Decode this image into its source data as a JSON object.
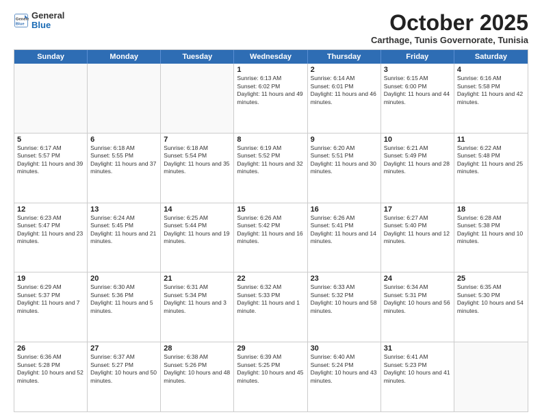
{
  "header": {
    "logo_line1": "General",
    "logo_line2": "Blue",
    "month": "October 2025",
    "location": "Carthage, Tunis Governorate, Tunisia"
  },
  "days_of_week": [
    "Sunday",
    "Monday",
    "Tuesday",
    "Wednesday",
    "Thursday",
    "Friday",
    "Saturday"
  ],
  "weeks": [
    [
      {
        "day": "",
        "text": ""
      },
      {
        "day": "",
        "text": ""
      },
      {
        "day": "",
        "text": ""
      },
      {
        "day": "1",
        "text": "Sunrise: 6:13 AM\nSunset: 6:02 PM\nDaylight: 11 hours and 49 minutes."
      },
      {
        "day": "2",
        "text": "Sunrise: 6:14 AM\nSunset: 6:01 PM\nDaylight: 11 hours and 46 minutes."
      },
      {
        "day": "3",
        "text": "Sunrise: 6:15 AM\nSunset: 6:00 PM\nDaylight: 11 hours and 44 minutes."
      },
      {
        "day": "4",
        "text": "Sunrise: 6:16 AM\nSunset: 5:58 PM\nDaylight: 11 hours and 42 minutes."
      }
    ],
    [
      {
        "day": "5",
        "text": "Sunrise: 6:17 AM\nSunset: 5:57 PM\nDaylight: 11 hours and 39 minutes."
      },
      {
        "day": "6",
        "text": "Sunrise: 6:18 AM\nSunset: 5:55 PM\nDaylight: 11 hours and 37 minutes."
      },
      {
        "day": "7",
        "text": "Sunrise: 6:18 AM\nSunset: 5:54 PM\nDaylight: 11 hours and 35 minutes."
      },
      {
        "day": "8",
        "text": "Sunrise: 6:19 AM\nSunset: 5:52 PM\nDaylight: 11 hours and 32 minutes."
      },
      {
        "day": "9",
        "text": "Sunrise: 6:20 AM\nSunset: 5:51 PM\nDaylight: 11 hours and 30 minutes."
      },
      {
        "day": "10",
        "text": "Sunrise: 6:21 AM\nSunset: 5:49 PM\nDaylight: 11 hours and 28 minutes."
      },
      {
        "day": "11",
        "text": "Sunrise: 6:22 AM\nSunset: 5:48 PM\nDaylight: 11 hours and 25 minutes."
      }
    ],
    [
      {
        "day": "12",
        "text": "Sunrise: 6:23 AM\nSunset: 5:47 PM\nDaylight: 11 hours and 23 minutes."
      },
      {
        "day": "13",
        "text": "Sunrise: 6:24 AM\nSunset: 5:45 PM\nDaylight: 11 hours and 21 minutes."
      },
      {
        "day": "14",
        "text": "Sunrise: 6:25 AM\nSunset: 5:44 PM\nDaylight: 11 hours and 19 minutes."
      },
      {
        "day": "15",
        "text": "Sunrise: 6:26 AM\nSunset: 5:42 PM\nDaylight: 11 hours and 16 minutes."
      },
      {
        "day": "16",
        "text": "Sunrise: 6:26 AM\nSunset: 5:41 PM\nDaylight: 11 hours and 14 minutes."
      },
      {
        "day": "17",
        "text": "Sunrise: 6:27 AM\nSunset: 5:40 PM\nDaylight: 11 hours and 12 minutes."
      },
      {
        "day": "18",
        "text": "Sunrise: 6:28 AM\nSunset: 5:38 PM\nDaylight: 11 hours and 10 minutes."
      }
    ],
    [
      {
        "day": "19",
        "text": "Sunrise: 6:29 AM\nSunset: 5:37 PM\nDaylight: 11 hours and 7 minutes."
      },
      {
        "day": "20",
        "text": "Sunrise: 6:30 AM\nSunset: 5:36 PM\nDaylight: 11 hours and 5 minutes."
      },
      {
        "day": "21",
        "text": "Sunrise: 6:31 AM\nSunset: 5:34 PM\nDaylight: 11 hours and 3 minutes."
      },
      {
        "day": "22",
        "text": "Sunrise: 6:32 AM\nSunset: 5:33 PM\nDaylight: 11 hours and 1 minute."
      },
      {
        "day": "23",
        "text": "Sunrise: 6:33 AM\nSunset: 5:32 PM\nDaylight: 10 hours and 58 minutes."
      },
      {
        "day": "24",
        "text": "Sunrise: 6:34 AM\nSunset: 5:31 PM\nDaylight: 10 hours and 56 minutes."
      },
      {
        "day": "25",
        "text": "Sunrise: 6:35 AM\nSunset: 5:30 PM\nDaylight: 10 hours and 54 minutes."
      }
    ],
    [
      {
        "day": "26",
        "text": "Sunrise: 6:36 AM\nSunset: 5:28 PM\nDaylight: 10 hours and 52 minutes."
      },
      {
        "day": "27",
        "text": "Sunrise: 6:37 AM\nSunset: 5:27 PM\nDaylight: 10 hours and 50 minutes."
      },
      {
        "day": "28",
        "text": "Sunrise: 6:38 AM\nSunset: 5:26 PM\nDaylight: 10 hours and 48 minutes."
      },
      {
        "day": "29",
        "text": "Sunrise: 6:39 AM\nSunset: 5:25 PM\nDaylight: 10 hours and 45 minutes."
      },
      {
        "day": "30",
        "text": "Sunrise: 6:40 AM\nSunset: 5:24 PM\nDaylight: 10 hours and 43 minutes."
      },
      {
        "day": "31",
        "text": "Sunrise: 6:41 AM\nSunset: 5:23 PM\nDaylight: 10 hours and 41 minutes."
      },
      {
        "day": "",
        "text": ""
      }
    ]
  ]
}
